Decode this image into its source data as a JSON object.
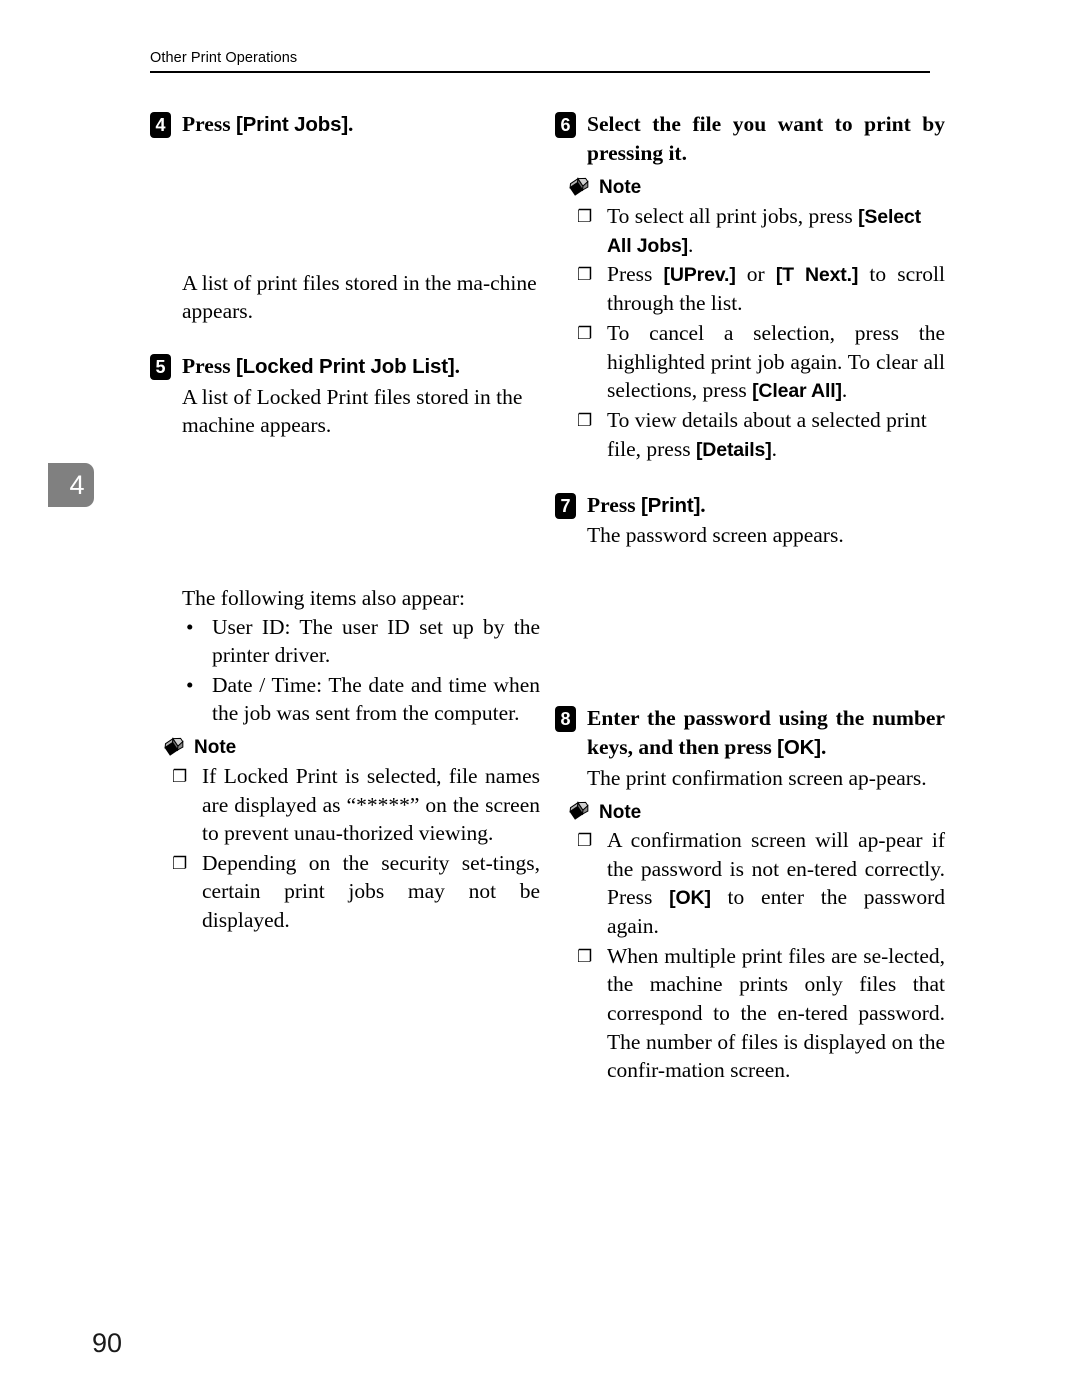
{
  "header": {
    "title": "Other Print Operations"
  },
  "chapter_tab": {
    "number": "4"
  },
  "folio": {
    "page_number": "90"
  },
  "icons": {
    "note_icon": "pencil-icon",
    "note_bullet": "❐"
  },
  "left_column": {
    "step4": {
      "badge": "4",
      "title_pre": "Press ",
      "title_key": "[Print Jobs]",
      "title_post": "."
    },
    "step4_result": "A list of print files stored in the ma-chine appears.",
    "step5": {
      "badge": "5",
      "title_pre": "Press ",
      "title_key": "[Locked Print Job List]",
      "title_post": "."
    },
    "step5_result": "A list of Locked Print files stored in the machine appears.",
    "items_intro": "The following items also appear:",
    "bullets": [
      "User ID: The user ID set up by the printer driver.",
      "Date / Time: The date and time when the job was sent from the computer."
    ],
    "note": {
      "label": "Note",
      "items": [
        "If Locked Print is selected, file names are displayed as “*****” on the screen to prevent unau-thorized viewing.",
        "Depending on the security set-tings, certain print jobs may not be displayed."
      ]
    }
  },
  "right_column": {
    "step6": {
      "badge": "6",
      "title": "Select the file you want to print by pressing it."
    },
    "step6_note": {
      "label": "Note",
      "items": [
        {
          "pre": "To select all print jobs, press ",
          "key": "[Select All Jobs]",
          "post": "."
        },
        {
          "pre": "Press ",
          "key": "[UPrev.]",
          "mid": " or ",
          "key2": "[T Next.]",
          "post": " to scroll through the list."
        },
        {
          "pre": "To cancel a selection, press the highlighted print job again. To clear all selections, press ",
          "key": "[Clear All]",
          "post": "."
        },
        {
          "pre": "To view details about a selected print file, press ",
          "key": "[Details]",
          "post": "."
        }
      ]
    },
    "step7": {
      "badge": "7",
      "title_pre": "Press ",
      "title_key": "[Print]",
      "title_post": "."
    },
    "step7_result": "The password screen appears.",
    "step8": {
      "badge": "8",
      "title_pre": "Enter the password using the number keys, and then press ",
      "title_key": "[OK]",
      "title_post": "."
    },
    "step8_result": "The print confirmation screen ap-pears.",
    "step8_note": {
      "label": "Note",
      "items": [
        {
          "pre": "A confirmation screen will ap-pear if the password is not en-tered correctly. Press ",
          "key": "[OK]",
          "post": " to enter the password again."
        },
        {
          "pre": "When multiple print files are se-lected, the machine prints only files that correspond to the en-tered password. The number of files is displayed on the confir-mation screen.",
          "key": "",
          "post": ""
        }
      ]
    }
  }
}
